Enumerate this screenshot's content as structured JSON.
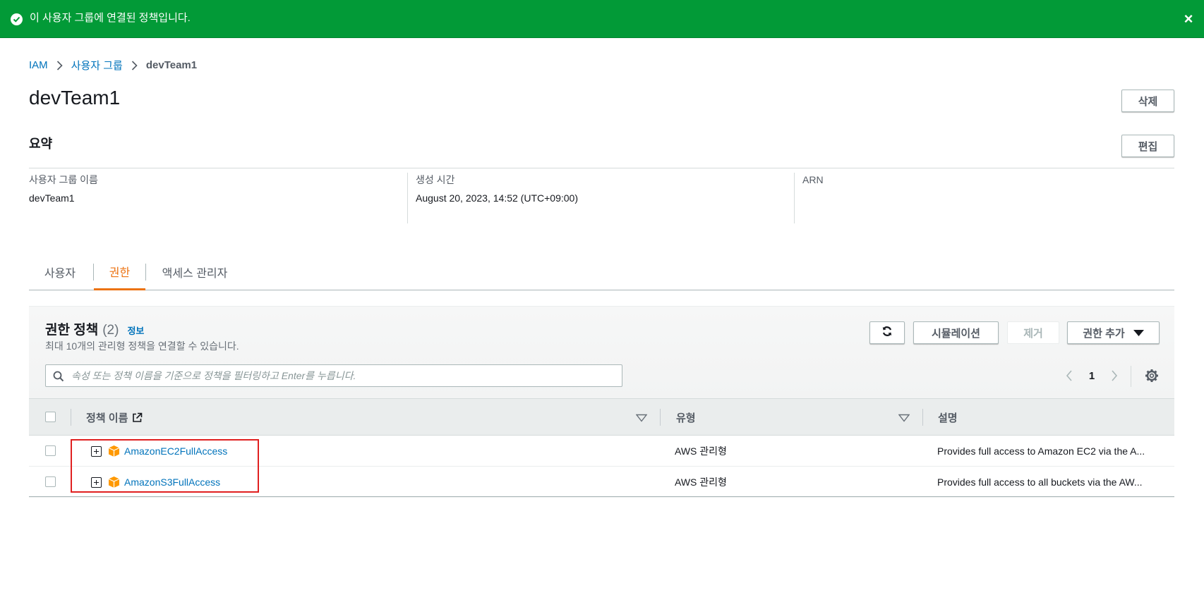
{
  "flash": {
    "message": "이 사용자 그룹에 연결된 정책입니다.",
    "close_label": "×",
    "color": "#029a37"
  },
  "breadcrumb": {
    "items": [
      "IAM",
      "사용자 그룹"
    ],
    "current": "devTeam1"
  },
  "page": {
    "title": "devTeam1",
    "delete_label": "삭제"
  },
  "summary": {
    "title": "요약",
    "edit_label": "편집",
    "fields": [
      {
        "label": "사용자 그룹 이름",
        "value": "devTeam1"
      },
      {
        "label": "생성 시간",
        "value": "August 20, 2023, 14:52 (UTC+09:00)"
      },
      {
        "label": "ARN",
        "value": ""
      }
    ]
  },
  "tabs": {
    "items": [
      {
        "label": "사용자",
        "active": false
      },
      {
        "label": "권한",
        "active": true
      },
      {
        "label": "액세스 관리자",
        "active": false
      }
    ],
    "active_color": "#ec7211"
  },
  "permissions": {
    "title": "권한 정책",
    "count": "(2)",
    "info_label": "정보",
    "description": "최대 10개의 관리형 정책을 연결할 수 있습니다.",
    "simulate_label": "시뮬레이션",
    "remove_label": "제거",
    "add_label": "권한 추가",
    "search_placeholder": "속성 또는 정책 이름을 기준으로 정책을 필터링하고 Enter를 누릅니다.",
    "page_number": "1",
    "columns": [
      "정책 이름",
      "유형",
      "설명"
    ],
    "rows": [
      {
        "name": "AmazonEC2FullAccess",
        "type": "AWS 관리형",
        "description": "Provides full access to Amazon EC2 via the A..."
      },
      {
        "name": "AmazonS3FullAccess",
        "type": "AWS 관리형",
        "description": "Provides full access to all buckets via the AW..."
      }
    ],
    "link_color": "#0073bb",
    "icon_color": "#ff9900"
  }
}
